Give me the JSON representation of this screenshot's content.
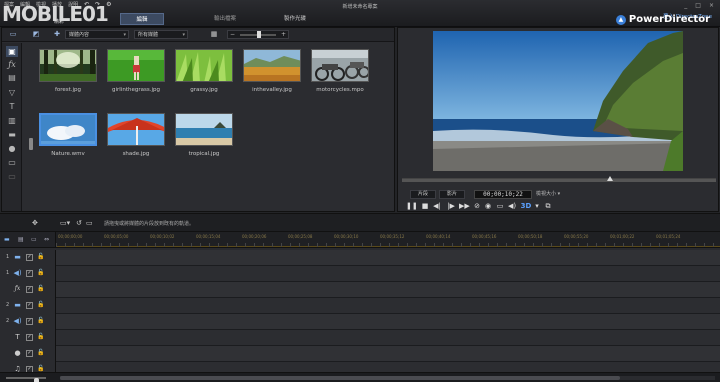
{
  "app": {
    "doc_title": "新增未命名專案",
    "brand": "PowerDirector",
    "login_link": "登入 DirectorZone",
    "watermark": "MOBILE01",
    "watermark_sub": "精彩"
  },
  "menus": [
    "檔案",
    "編輯",
    "檢視",
    "播放",
    "說明"
  ],
  "modes": [
    "編輯",
    "輸出檔案",
    "製作光碟"
  ],
  "library": {
    "dropdown_content": "媒體內容",
    "dropdown_filter": "所有媒體",
    "media": [
      {
        "name": "forest.jpg"
      },
      {
        "name": "girlinthegrass.jpg"
      },
      {
        "name": "grassy.jpg"
      },
      {
        "name": "inthevalley.jpg"
      },
      {
        "name": "motorcycles.mpo"
      },
      {
        "name": "Nature.wmv"
      },
      {
        "name": "shade.jpg"
      },
      {
        "name": "tropical.jpg"
      }
    ]
  },
  "preview": {
    "btn_clip": "片段",
    "btn_movie": "影片",
    "timecode": "00;00;10;22",
    "quality": "檢視大小"
  },
  "timeline_toolbar": {
    "hint": "請拖曳或將媒體的片段放到既有的軌道。"
  },
  "ruler": [
    "00;00;00;00",
    "00;00;05;00",
    "00;00;10;02",
    "00;00;15;04",
    "00;00;20;06",
    "00;00;25;08",
    "00;00;30;10",
    "00;00;35;12",
    "00;00;40;14",
    "00;00;45;16",
    "00;00;50;18",
    "00;00;55;20",
    "00;01;00;22",
    "00;01;05;24"
  ],
  "tracks": [
    {
      "num": "1",
      "type": "video"
    },
    {
      "num": "1",
      "type": "audio"
    },
    {
      "num": "",
      "type": "fx"
    },
    {
      "num": "2",
      "type": "video"
    },
    {
      "num": "2",
      "type": "audio"
    },
    {
      "num": "",
      "type": "title"
    },
    {
      "num": "",
      "type": "voice"
    },
    {
      "num": "",
      "type": "music"
    }
  ]
}
